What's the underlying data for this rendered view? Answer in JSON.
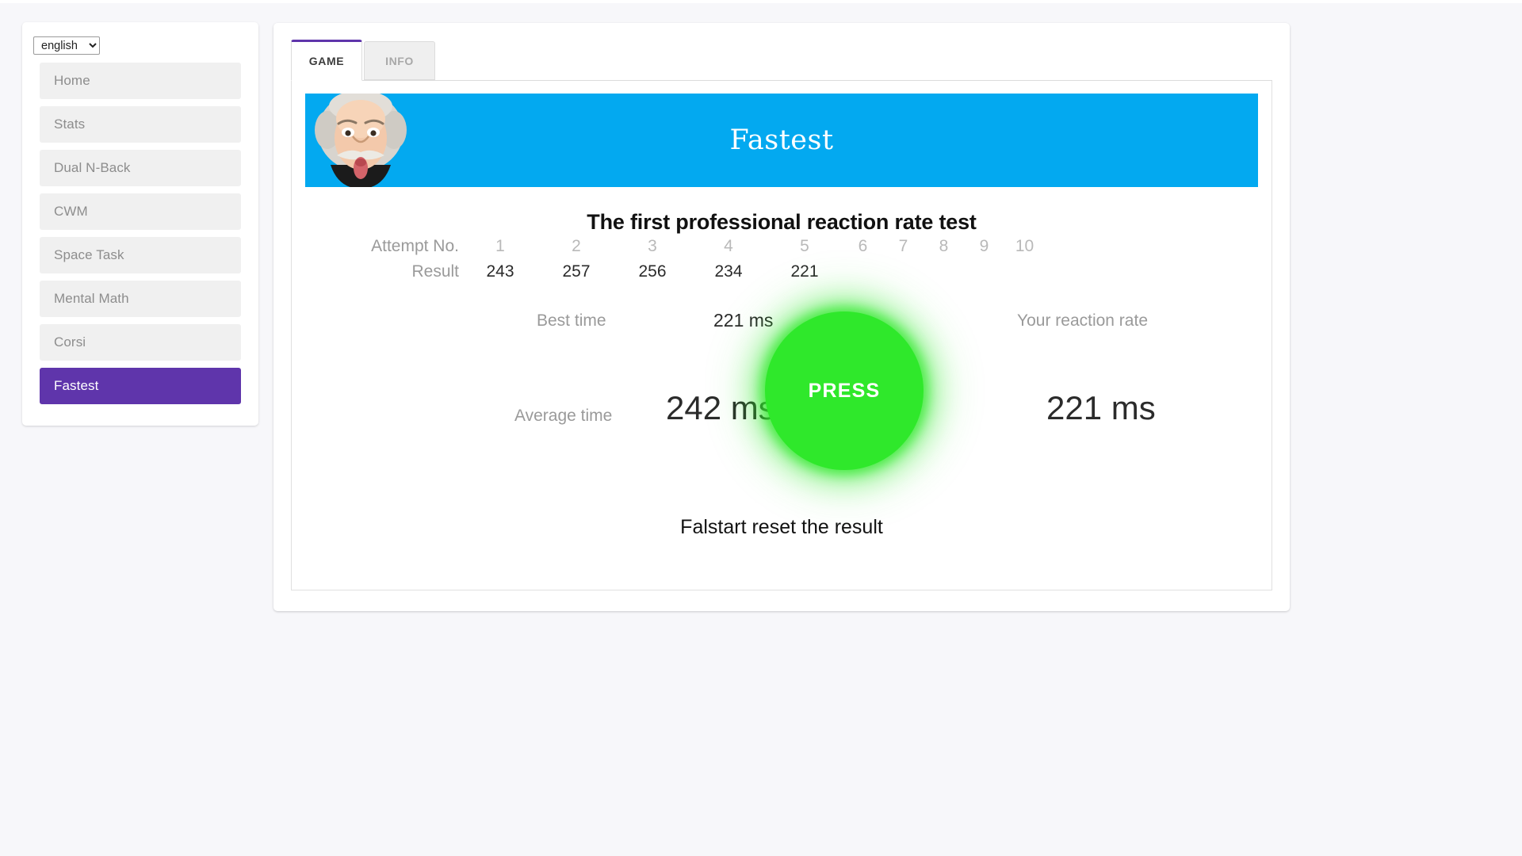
{
  "sidebar": {
    "language_select": {
      "value": "english",
      "options": [
        "english"
      ]
    },
    "items": [
      {
        "label": "Home",
        "active": false
      },
      {
        "label": "Stats",
        "active": false
      },
      {
        "label": "Dual N-Back",
        "active": false
      },
      {
        "label": "CWM",
        "active": false
      },
      {
        "label": "Space Task",
        "active": false
      },
      {
        "label": "Mental Math",
        "active": false
      },
      {
        "label": "Corsi",
        "active": false
      },
      {
        "label": "Fastest",
        "active": true
      }
    ]
  },
  "tabs": [
    {
      "label": "GAME",
      "active": true
    },
    {
      "label": "INFO",
      "active": false
    }
  ],
  "banner": {
    "title": "Fastest",
    "icon": "einstein-caricature",
    "background_color": "#03a9f0"
  },
  "game": {
    "heading": "The first professional reaction rate test",
    "attempt_row_label": "Attempt No.",
    "result_row_label": "Result",
    "attempt_numbers": [
      "1",
      "2",
      "3",
      "4",
      "5",
      "6",
      "7",
      "8",
      "9",
      "10"
    ],
    "results": [
      "243",
      "257",
      "256",
      "234",
      "221",
      "",
      "",
      "",
      "",
      ""
    ],
    "best_time_label": "Best time",
    "best_time_value": "221 ms",
    "average_time_label": "Average time",
    "average_time_value": "242 ms",
    "reaction_rate_label": "Your reaction rate",
    "reaction_rate_value": "221 ms",
    "press_button_label": "PRESS",
    "press_button_color": "#2fe82b",
    "falstart_note": "Falstart reset the result"
  },
  "theme": {
    "accent": "#5f35ab",
    "banner": "#03a9f0",
    "press_green": "#2fe82b",
    "page_background": "#f7f7fa"
  }
}
